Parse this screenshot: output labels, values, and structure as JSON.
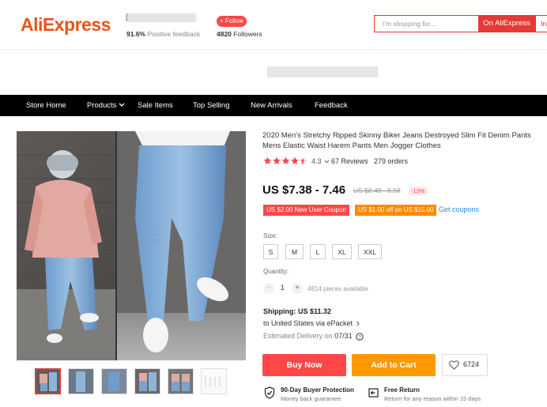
{
  "header": {
    "logo": "AliExpress",
    "store_initial": "[",
    "feedback_value": "91.6%",
    "feedback_label": "Positive feedback",
    "follow_label": "+ Follow",
    "followers_value": "4820",
    "followers_label": "Followers",
    "search_placeholder": "I'm shopping for...",
    "search_button": "On AliExpress",
    "search_button_2": "In"
  },
  "nav": {
    "items": [
      "Store Home",
      "Products",
      "Sale Items",
      "Top Selling",
      "New Arrivals",
      "Feedback"
    ]
  },
  "product": {
    "title": "2020 Men's Stretchy Ripped Skinny Biker Jeans Destroyed Slim Fit Denim Pants Mens Elastic Waist Harem Pants Men Jogger Clothes",
    "rating_value": 4.3,
    "rating_text": "4.3",
    "reviews": "67 Reviews",
    "orders": "279 orders",
    "price": "US $7.38 - 7.46",
    "original_price": "US $8.48 - 8.58",
    "discount": "-13%",
    "coupon_new_user": "US $2.00 New User Coupon",
    "coupon_off": "US $1.00 off on US $15.00",
    "get_coupons": "Get coupons",
    "size_label": "Size:",
    "sizes": [
      "S",
      "M",
      "L",
      "XL",
      "XXL"
    ],
    "quantity_label": "Quantity:",
    "quantity_minus": "−",
    "quantity_value": "1",
    "quantity_plus": "+",
    "available": "4814 pieces available",
    "shipping_label": "Shipping:",
    "shipping_price": "US $11.32",
    "shipping_dest": "to United States via ePacket",
    "delivery_label": "Estimated Delivery on",
    "delivery_date": "07/31",
    "buy_now": "Buy Now",
    "add_to_cart": "Add to Cart",
    "wishlist_count": "6724",
    "guarantee_title": "90-Day Buyer Protection",
    "guarantee_sub": "Money back guarantee",
    "return_title": "Free Return",
    "return_sub": "Return for any reason within 15 days"
  },
  "colors": {
    "brand": "#e8541a",
    "accent_red": "#ff4747",
    "accent_orange": "#ff9900",
    "star": "#ff4747",
    "link": "#2a8fd6"
  }
}
